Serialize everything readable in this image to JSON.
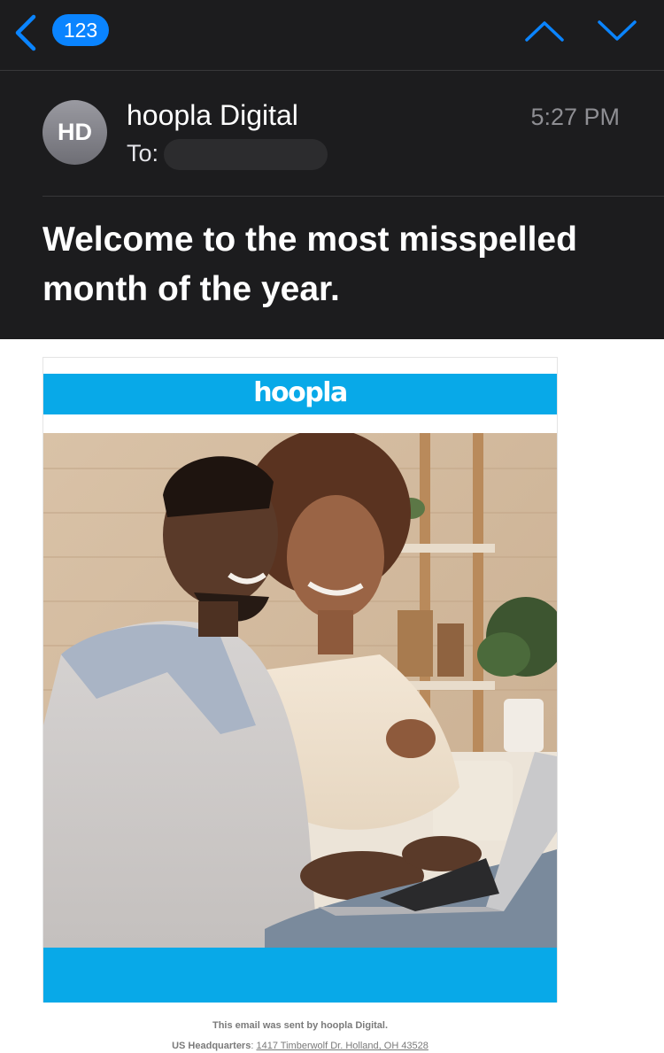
{
  "nav": {
    "unread_count": "123"
  },
  "message": {
    "avatar_initials": "HD",
    "sender": "hoopla Digital",
    "to_label": "To:",
    "time": "5:27 PM",
    "subject": "Welcome to the most misspelled month of the year."
  },
  "email_body": {
    "logo_text": "hoopla",
    "brand_color": "#08a9e8",
    "footer": {
      "sent_by": "This email was sent by hoopla Digital.",
      "hq_label": "US Headquarters",
      "hq_separator": ": ",
      "hq_address": "1417 Timberwolf Dr. Holland, OH 43528"
    }
  },
  "colors": {
    "accent": "#0a84ff",
    "header_bg": "#1c1c1e"
  }
}
